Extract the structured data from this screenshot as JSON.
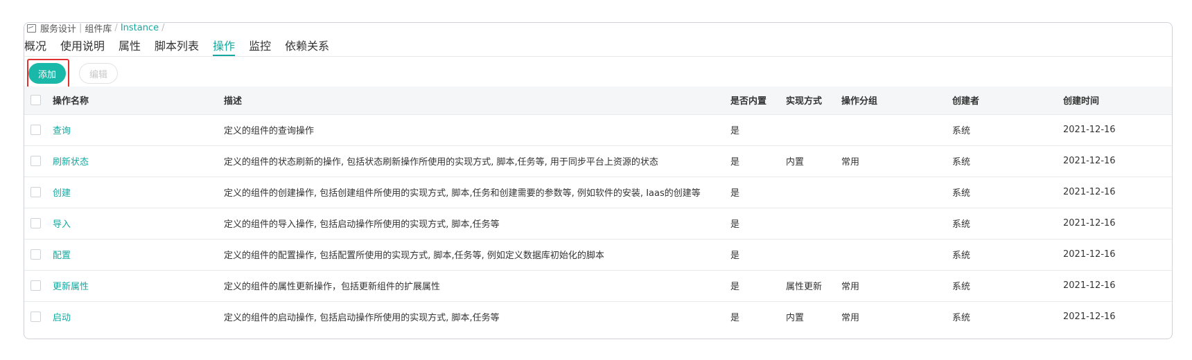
{
  "breadcrumb": {
    "items": [
      "服务设计",
      "组件库",
      "Instance"
    ],
    "separator": "/"
  },
  "tabs": [
    {
      "label": "概况",
      "active": false
    },
    {
      "label": "使用说明",
      "active": false
    },
    {
      "label": "属性",
      "active": false
    },
    {
      "label": "脚本列表",
      "active": false
    },
    {
      "label": "操作",
      "active": true
    },
    {
      "label": "监控",
      "active": false
    },
    {
      "label": "依赖关系",
      "active": false
    }
  ],
  "toolbar": {
    "add_label": "添加",
    "edit_label": "编辑"
  },
  "table": {
    "headers": [
      "操作名称",
      "描述",
      "是否内置",
      "实现方式",
      "操作分组",
      "创建者",
      "创建时间"
    ],
    "rows": [
      [
        "查询",
        "定义的组件的查询操作",
        "是",
        "",
        "",
        "系统",
        "2021-12-16"
      ],
      [
        "刷新状态",
        "定义的组件的状态刷新的操作, 包括状态刷新操作所使用的实现方式, 脚本,任务等, 用于同步平台上资源的状态",
        "是",
        "内置",
        "常用",
        "系统",
        "2021-12-16"
      ],
      [
        "创建",
        "定义的组件的创建操作, 包括创建组件所使用的实现方式, 脚本,任务和创建需要的参数等, 例如软件的安装, Iaas的创建等",
        "是",
        "",
        "",
        "系统",
        "2021-12-16"
      ],
      [
        "导入",
        "定义的组件的导入操作, 包括启动操作所使用的实现方式, 脚本,任务等",
        "是",
        "",
        "",
        "系统",
        "2021-12-16"
      ],
      [
        "配置",
        "定义的组件的配置操作, 包括配置所使用的实现方式, 脚本,任务等, 例如定义数据库初始化的脚本",
        "是",
        "",
        "",
        "系统",
        "2021-12-16"
      ],
      [
        "更新属性",
        "定义的组件的属性更新操作，包括更新组件的扩展属性",
        "是",
        "属性更新",
        "常用",
        "系统",
        "2021-12-16"
      ],
      [
        "启动",
        "定义的组件的启动操作, 包括启动操作所使用的实现方式, 脚本,任务等",
        "是",
        "内置",
        "常用",
        "系统",
        "2021-12-16"
      ]
    ]
  },
  "colors": {
    "accent": "#14a8a0",
    "button": "#1ab8a9",
    "highlight_border": "#e0332f"
  }
}
